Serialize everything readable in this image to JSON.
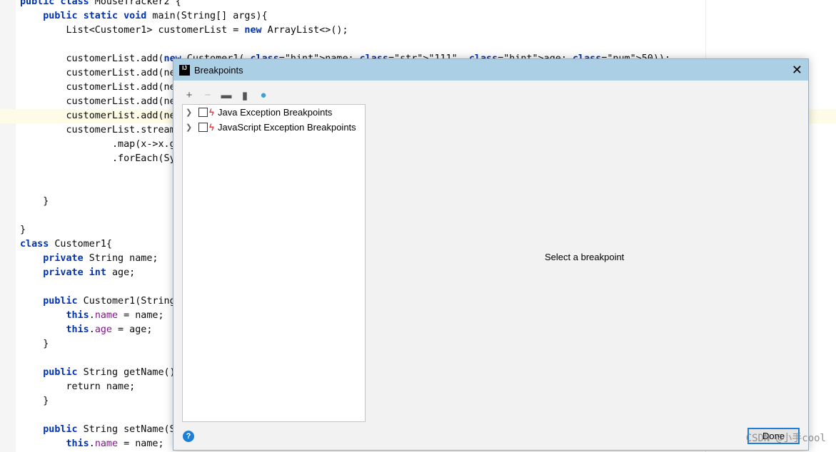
{
  "editor": {
    "lines": [
      "public class MouseTracker2 {",
      "    public static void main(String[] args){",
      "        List<Customer1> customerList = new ArrayList<>();",
      "",
      "        customerList.add(new Customer1( name: \"111\", age: 50));",
      "        customerList.add(ne",
      "        customerList.add(ne",
      "        customerList.add(ne",
      "        customerList.add(ne",
      "        customerList.stream",
      "                .map(x->x.g",
      "                .forEach(Sy",
      "",
      "",
      "    }",
      "",
      "}",
      "class Customer1{",
      "    private String name;",
      "    private int age;",
      "",
      "    public Customer1(String",
      "        this.name = name;",
      "        this.age = age;",
      "    }",
      "",
      "    public String getName()",
      "        return name;",
      "    }",
      "",
      "    public String setName(S",
      "        this.name = name;"
    ]
  },
  "dialog": {
    "title": "Breakpoints",
    "tree": [
      {
        "label": "Java Exception Breakpoints"
      },
      {
        "label": "JavaScript Exception Breakpoints"
      }
    ],
    "empty_text": "Select a breakpoint",
    "done_label": "Done",
    "help": "?"
  },
  "watermark": "CSDN @小手cool"
}
